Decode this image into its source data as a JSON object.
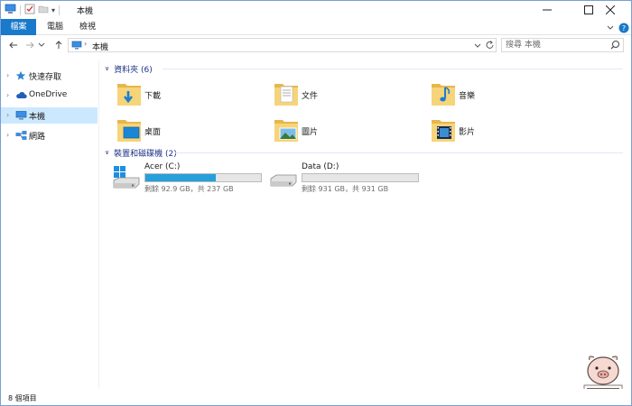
{
  "window": {
    "title": "本機"
  },
  "ribbon": {
    "tabs": [
      {
        "label": "檔案",
        "active": true
      },
      {
        "label": "電腦",
        "active": false
      },
      {
        "label": "檢視",
        "active": false
      }
    ]
  },
  "address": {
    "path": "本機",
    "search_placeholder": "搜尋 本機"
  },
  "nav_pane": {
    "items": [
      {
        "label": "快速存取",
        "icon": "star-icon"
      },
      {
        "label": "OneDrive",
        "icon": "cloud-icon"
      },
      {
        "label": "本機",
        "icon": "computer-icon",
        "selected": true
      },
      {
        "label": "網路",
        "icon": "network-icon"
      }
    ]
  },
  "folders_group": {
    "header": "資料夾 (6)",
    "items": [
      {
        "label": "下載",
        "icon": "downloads-folder-icon"
      },
      {
        "label": "文件",
        "icon": "documents-folder-icon"
      },
      {
        "label": "音樂",
        "icon": "music-folder-icon"
      },
      {
        "label": "桌面",
        "icon": "desktop-folder-icon"
      },
      {
        "label": "圖片",
        "icon": "pictures-folder-icon"
      },
      {
        "label": "影片",
        "icon": "videos-folder-icon"
      }
    ]
  },
  "devices_group": {
    "header": "裝置和磁碟機 (2)",
    "drives": [
      {
        "name": "Acer (C:)",
        "free_text": "剩餘 92.9 GB，共 237 GB",
        "used_fraction": 0.608,
        "icon": "windows-drive-icon"
      },
      {
        "name": "Data (D:)",
        "free_text": "剩餘 931 GB，共 931 GB",
        "used_fraction": 0.0,
        "icon": "hard-drive-icon"
      }
    ]
  },
  "status": {
    "item_count": "8 個項目"
  },
  "colors": {
    "accent": "#1979ca",
    "selection": "#cce8ff",
    "drive_fill": "#26a0da",
    "group_header": "#1e3287"
  }
}
